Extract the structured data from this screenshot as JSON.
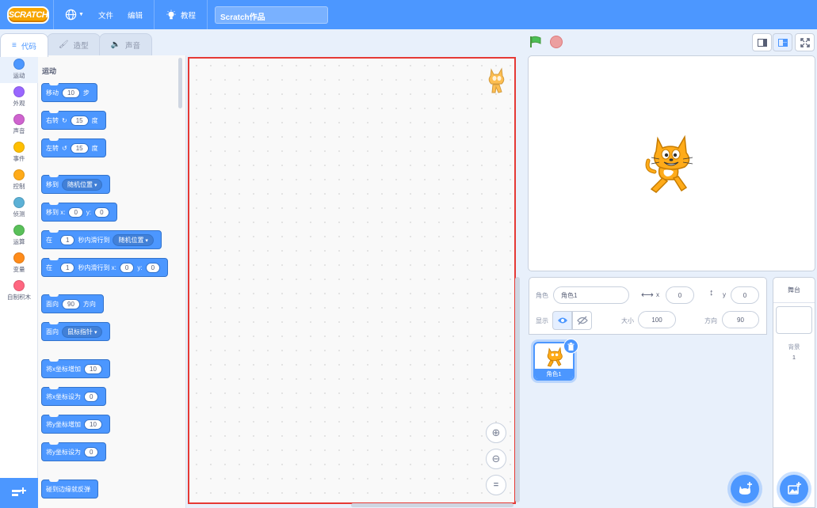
{
  "menubar": {
    "logo": "SCRATCH",
    "file": "文件",
    "edit": "编辑",
    "tutorials": "教程",
    "project_title": "Scratch作品"
  },
  "tabs": [
    {
      "label": "代码",
      "icon": "code-icon"
    },
    {
      "label": "造型",
      "icon": "brush-icon"
    },
    {
      "label": "声音",
      "icon": "speaker-icon"
    }
  ],
  "categories": [
    {
      "label": "运动",
      "color": "#4c97ff"
    },
    {
      "label": "外观",
      "color": "#9966ff"
    },
    {
      "label": "声音",
      "color": "#cf63cf"
    },
    {
      "label": "事件",
      "color": "#ffbf00"
    },
    {
      "label": "控制",
      "color": "#ffab19"
    },
    {
      "label": "侦测",
      "color": "#5cb1d6"
    },
    {
      "label": "运算",
      "color": "#59c059"
    },
    {
      "label": "变量",
      "color": "#ff8c1a"
    },
    {
      "label": "自制积木",
      "color": "#ff6680"
    }
  ],
  "palette": {
    "heading": "运动",
    "move": {
      "a": "移动",
      "v": "10",
      "b": "步"
    },
    "turn_right": {
      "a": "右转",
      "v": "15",
      "b": "度"
    },
    "turn_left": {
      "a": "左转",
      "v": "15",
      "b": "度"
    },
    "goto": {
      "a": "移到",
      "dd": "随机位置"
    },
    "goto_xy": {
      "a": "移到 x:",
      "x": "0",
      "b": "y:",
      "y": "0"
    },
    "glide": {
      "a": "在",
      "v": "1",
      "b": "秒内滑行到",
      "dd": "随机位置"
    },
    "glide_xy": {
      "a": "在",
      "v": "1",
      "b": "秒内滑行到 x:",
      "x": "0",
      "c": "y:",
      "y": "0"
    },
    "point_dir": {
      "a": "面向",
      "v": "90",
      "b": "方向"
    },
    "point_towards": {
      "a": "面向",
      "dd": "鼠标指针"
    },
    "change_x": {
      "a": "将x坐标增加",
      "v": "10"
    },
    "set_x": {
      "a": "将x坐标设为",
      "v": "0"
    },
    "change_y": {
      "a": "将y坐标增加",
      "v": "10"
    },
    "set_y": {
      "a": "将y坐标设为",
      "v": "0"
    },
    "bounce": {
      "a": "碰到边缘就反弹"
    }
  },
  "sprite_info": {
    "sprite_label": "角色",
    "sprite_name": "角色1",
    "x_label": "x",
    "x_value": "0",
    "y_label": "y",
    "y_value": "0",
    "show_label": "显示",
    "size_label": "大小",
    "size_value": "100",
    "direction_label": "方向",
    "direction_value": "90"
  },
  "sprites": [
    {
      "name": "角色1"
    }
  ],
  "stage_pane": {
    "title": "舞台",
    "backdrop_label": "背景",
    "backdrop_count": "1"
  }
}
